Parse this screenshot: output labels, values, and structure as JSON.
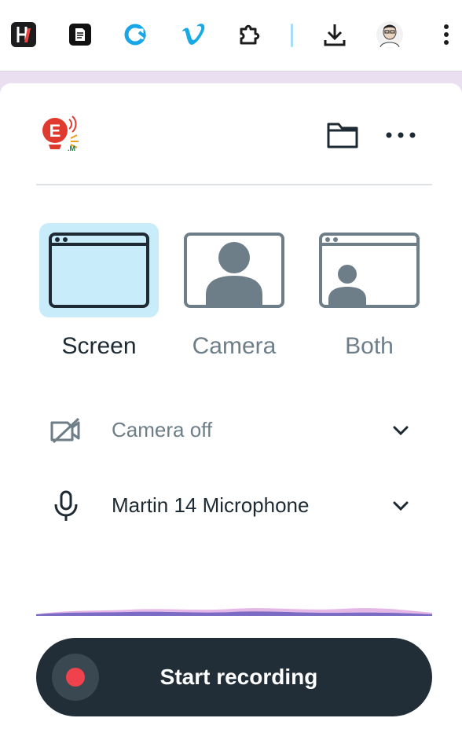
{
  "toolbar": {
    "extensions": [
      {
        "icon": "h-extension-icon",
        "name": "h-extension-button"
      },
      {
        "icon": "document-extension-icon",
        "name": "document-extension-button"
      },
      {
        "icon": "sync-extension-icon",
        "name": "sync-extension-button"
      },
      {
        "icon": "vimeo-icon",
        "name": "vimeo-extension-button"
      },
      {
        "icon": "puzzle-piece-icon",
        "name": "extensions-menu-button"
      },
      {
        "icon": "download-icon",
        "name": "downloads-button"
      },
      {
        "icon": "profile-avatar",
        "name": "profile-button"
      },
      {
        "icon": "kebab-menu-icon",
        "name": "browser-menu-button"
      }
    ],
    "logo_text": "E"
  },
  "header": {
    "logo_icon": "e-m-logo",
    "folder_icon": "folder-icon",
    "more_icon": "more-horizontal-icon"
  },
  "modes": [
    {
      "label": "Screen",
      "icon": "screen-window-icon",
      "selected": true
    },
    {
      "label": "Camera",
      "icon": "camera-person-icon",
      "selected": false
    },
    {
      "label": "Both",
      "icon": "screen-with-person-icon",
      "selected": false
    }
  ],
  "camera": {
    "label": "Camera off",
    "icon": "camera-off-icon",
    "chevron": "chevron-down-icon"
  },
  "microphone": {
    "label": "Martin 14 Microphone",
    "icon": "microphone-icon",
    "chevron": "chevron-down-icon"
  },
  "record": {
    "label": "Start recording",
    "dot_color": "#f0424d"
  },
  "colors": {
    "accent_selected": "#c9ecfb",
    "dark": "#222e37",
    "muted": "#6e7e89",
    "wave_purple": "#7a6bc4",
    "wave_pink": "#e4b7e6"
  }
}
